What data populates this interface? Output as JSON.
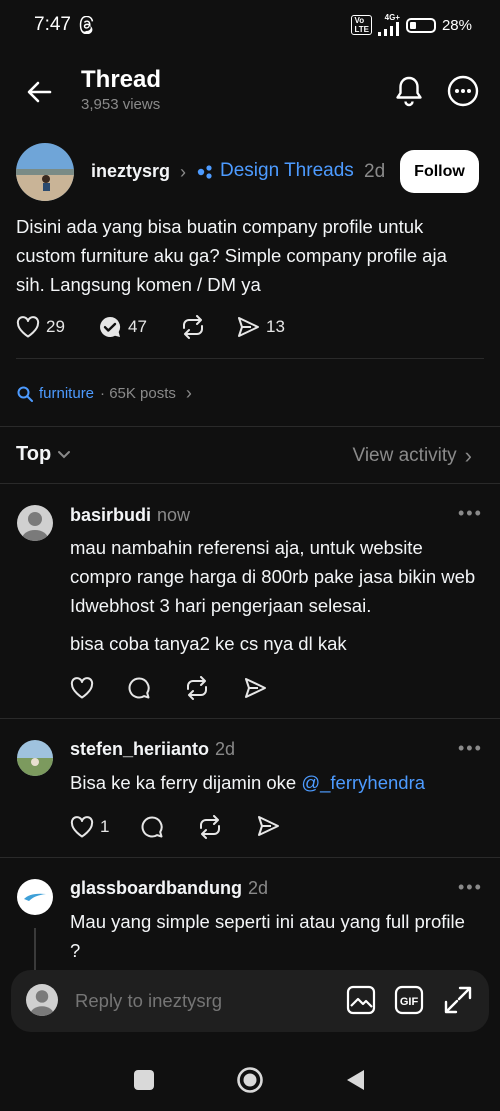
{
  "status": {
    "time": "7:47",
    "network": "4G+",
    "battery": "28%"
  },
  "header": {
    "title": "Thread",
    "views": "3,953 views"
  },
  "post": {
    "username": "ineztysrg",
    "topic": "Design Threads",
    "age": "2d",
    "follow_label": "Follow",
    "text": "Disini ada yang bisa buatin company profile untuk custom furniture aku ga? Simple company profile aja sih. Langsung komen / DM ya",
    "likes": "29",
    "reposts": "47",
    "shares": "13"
  },
  "tag": {
    "name": "furniture",
    "meta": "· 65K posts"
  },
  "sort": {
    "label": "Top",
    "activity_label": "View activity"
  },
  "replies": [
    {
      "username": "basirbudi",
      "age": "now",
      "text": "mau nambahin referensi aja, untuk website compro range harga di 800rb pake jasa bikin web Idwebhost 3 hari pengerjaan selesai.",
      "text2": "bisa coba tanya2 ke cs nya dl kak",
      "likes": ""
    },
    {
      "username": "stefen_heriianto",
      "age": "2d",
      "text": "Bisa ke ka ferry dijamin oke ",
      "mention": "@_ferryhendra",
      "likes": "1"
    },
    {
      "username": "glassboardbandung",
      "age": "2d",
      "text": "Mau yang simple seperti ini atau yang full profile ?"
    }
  ],
  "composer": {
    "placeholder": "Reply to ineztysrg"
  },
  "colors": {
    "accent": "#4d9bff",
    "background": "#101010"
  }
}
